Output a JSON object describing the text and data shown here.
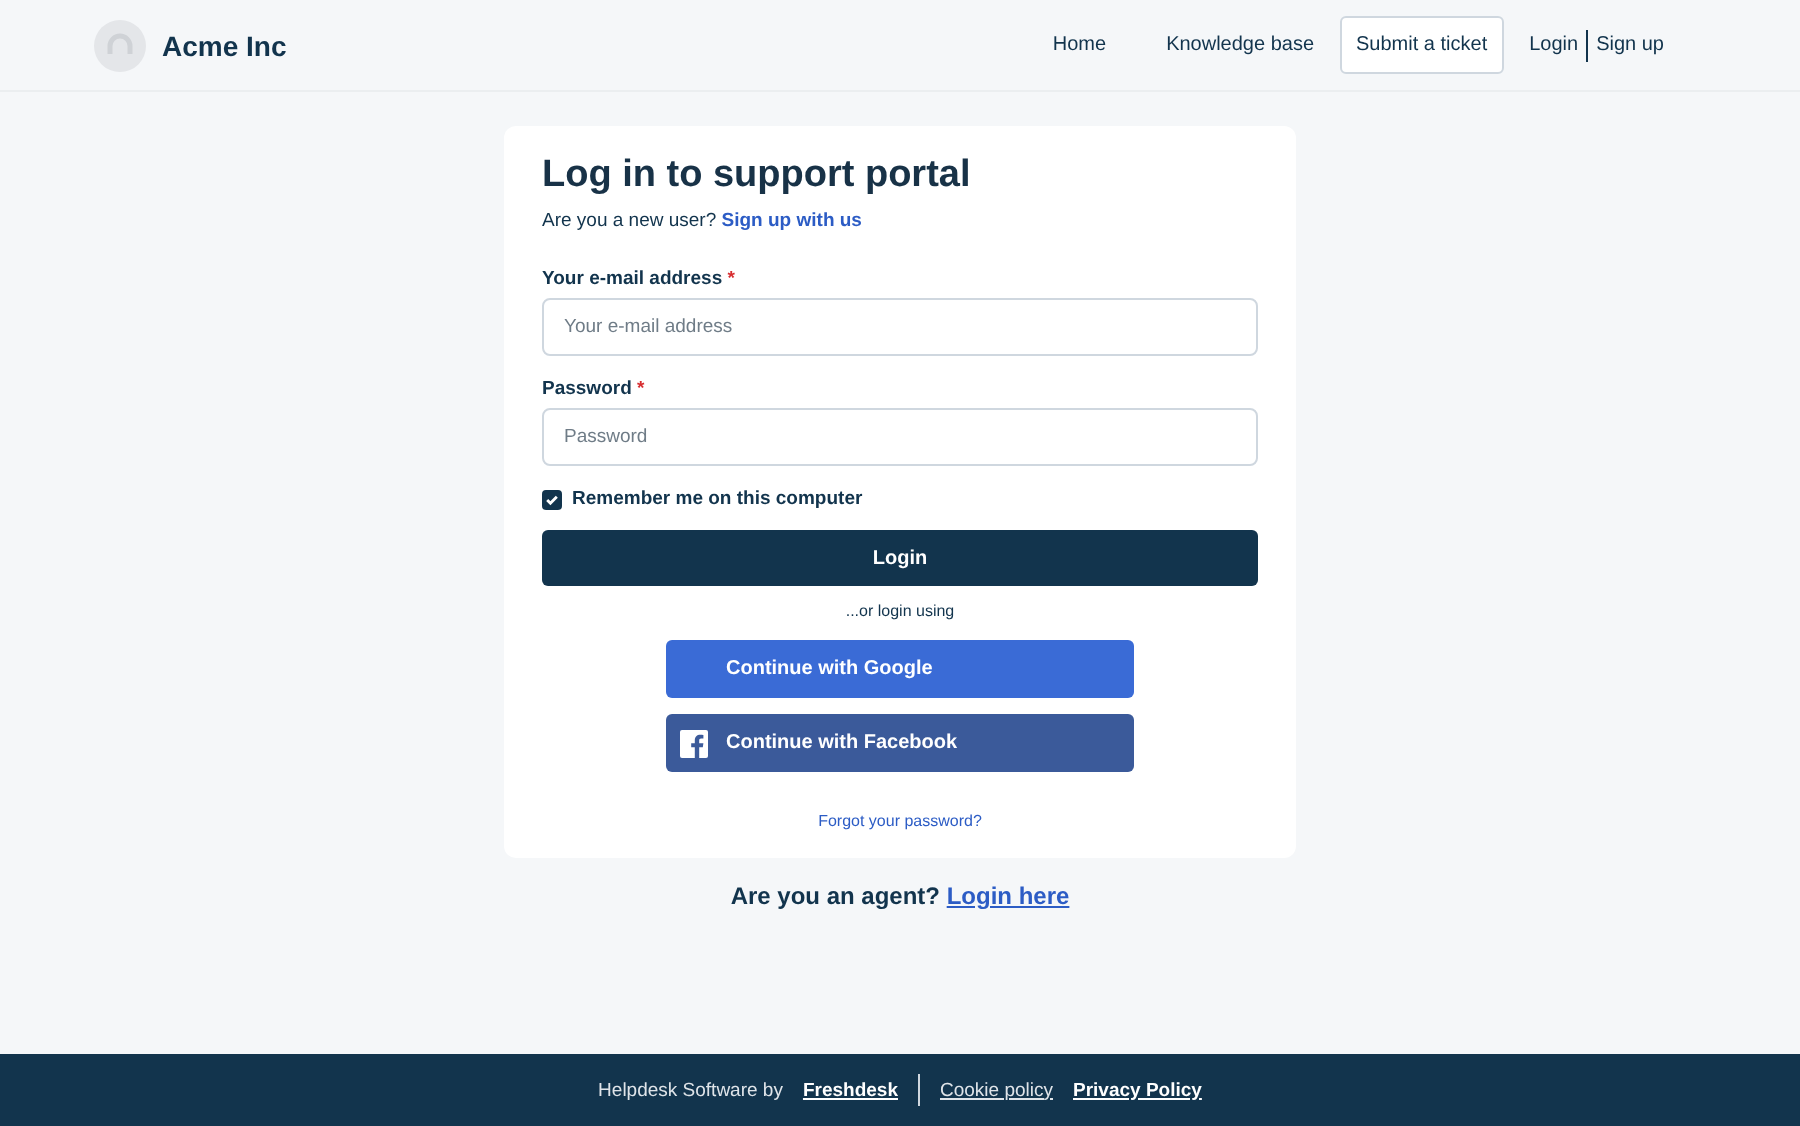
{
  "header": {
    "brand": "Acme Inc",
    "nav": [
      {
        "label": "Home",
        "kind": "link"
      },
      {
        "label": "Knowledge base",
        "kind": "link"
      },
      {
        "label": "Submit a ticket",
        "kind": "button"
      }
    ],
    "auth": [
      "Login",
      "Sign up"
    ]
  },
  "card": {
    "title": "Log in to support portal",
    "prompt": "Are you a new user?",
    "signup_link": "Sign up with us",
    "fields": [
      {
        "label": "Your e-mail address",
        "required_mark": "*",
        "placeholder": "Your e-mail address"
      },
      {
        "label": "Password",
        "required_mark": "*",
        "placeholder": "Password"
      }
    ],
    "remember": {
      "label": "Remember me on this computer",
      "checked": true
    },
    "login_button": "Login",
    "alt_text": "...or login using",
    "social": [
      {
        "label": "Continue with Google",
        "kind": "google"
      },
      {
        "label": "Continue with Facebook",
        "kind": "facebook"
      }
    ],
    "forgot": "Forgot your password?"
  },
  "agent": {
    "text": "Are you an agent?",
    "link": "Login here"
  },
  "footer": {
    "text": "Helpdesk Software by",
    "links": [
      "Freshdesk",
      "Cookie policy",
      "Privacy Policy"
    ]
  }
}
